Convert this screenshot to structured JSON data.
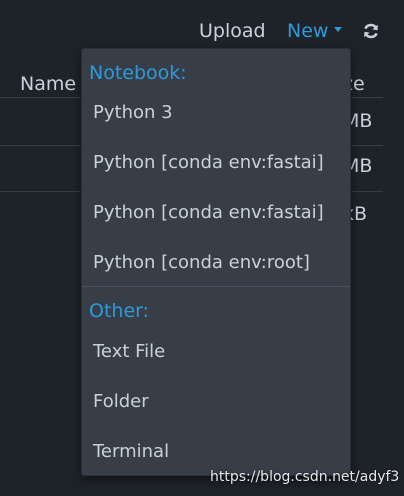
{
  "toolbar": {
    "upload_label": "Upload",
    "new_label": "New",
    "refresh_icon": "refresh-icon"
  },
  "file_list": {
    "name_header": "Name",
    "size_header_visible": "ze",
    "size_cells_visible": [
      "MB",
      "MB",
      "kB"
    ]
  },
  "new_menu": {
    "notebook_header": "Notebook:",
    "notebook_items": [
      "Python 3",
      "Python [conda env:fastai]",
      "Python [conda env:fastai]",
      "Python [conda env:root]"
    ],
    "other_header": "Other:",
    "other_items": [
      "Text File",
      "Folder",
      "Terminal"
    ]
  },
  "watermark": "https://blog.csdn.net/adyf3",
  "colors": {
    "background": "#1e2329",
    "menu_background": "#373e48",
    "accent": "#2e9ad8",
    "text": "#c9d1da"
  }
}
